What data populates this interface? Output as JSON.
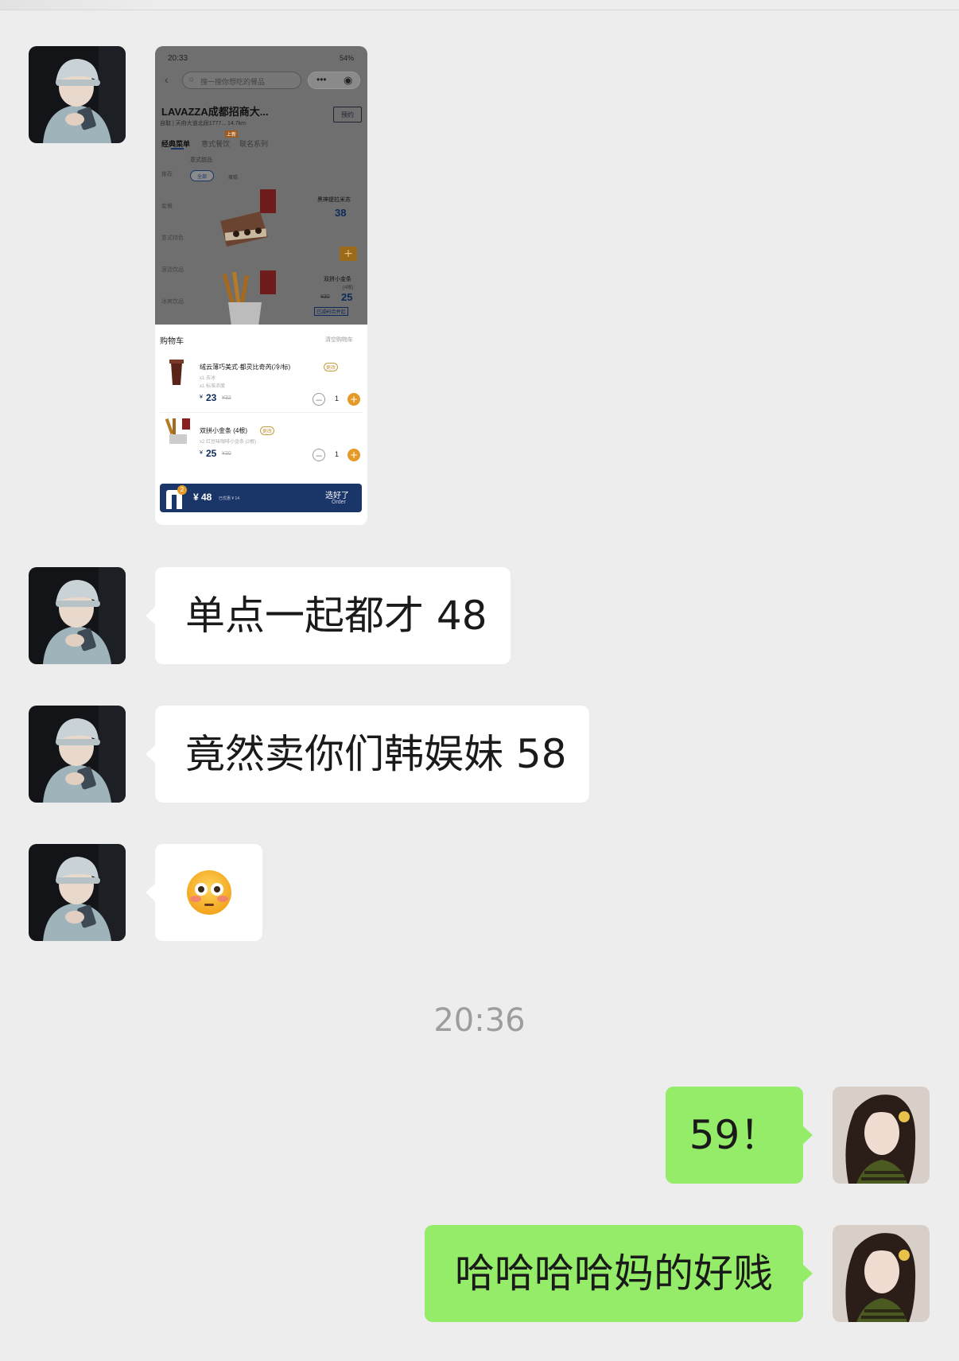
{
  "screenshot": {
    "status_time": "20:33",
    "status_battery": "54%",
    "search_placeholder": "搜一搜你想吃的餐品",
    "store_name": "LAVAZZA成都招商大...",
    "store_sub": "自取 | 天府大道北段1777...   14.7km",
    "reserve_label": "预约",
    "tabs": [
      "经典菜单",
      "意式餐饮",
      "联名系列"
    ],
    "tab_badge": "上新",
    "section_label": "意式甜品",
    "side_cats": [
      "推荐",
      "套餐",
      "意式特色",
      "滚烫饮品",
      "冰爽饮品"
    ],
    "filter_chips": [
      "全部",
      "蛋糕"
    ],
    "item1": {
      "name": "黑神提拉米苏",
      "price": "38"
    },
    "item2": {
      "name": "双拼小金条",
      "sub": "(4根)",
      "old_price": "¥30",
      "price": "25",
      "tag": "已减¥5合并起"
    },
    "cart_title": "购物车",
    "cart_clear": "清空购物车",
    "cart_items": [
      {
        "name": "绒云薄巧美式·都灵比奇芮(冷/标)",
        "tag": "更改",
        "opts": [
          "x1 去冰",
          "x1 标准浓度"
        ],
        "price": "23",
        "old_price": "¥32",
        "qty": "1"
      },
      {
        "name": "双拼小金条 (4根)",
        "tag": "更改",
        "opts": [
          "x2 红豆味咖啡小金条 (2根)"
        ],
        "price": "25",
        "old_price": "¥30",
        "qty": "1"
      }
    ],
    "total": "¥ 48",
    "saved": "已优惠 ¥ 14",
    "badge_count": "2",
    "order_label": "选好了",
    "order_sub": "Order"
  },
  "messages": [
    {
      "side": "left",
      "text": "单点一起都才 48"
    },
    {
      "side": "left",
      "text": "竟然卖你们韩娱妹 58"
    },
    {
      "side": "left",
      "text": "😳"
    }
  ],
  "timestamp": "20:36",
  "my_messages": [
    {
      "side": "right",
      "text": "59！"
    },
    {
      "side": "right",
      "text": "哈哈哈哈妈的好贱"
    }
  ],
  "colors": {
    "background": "#ededed",
    "bubble_in": "#ffffff",
    "bubble_out": "#95ec69",
    "order_bar": "#1a3669",
    "accent_orange": "#e59a28"
  }
}
